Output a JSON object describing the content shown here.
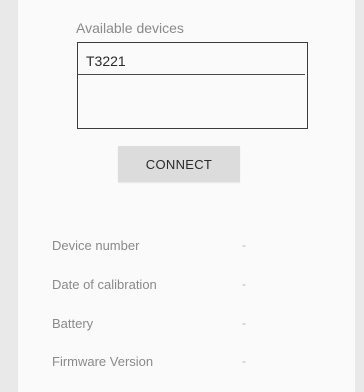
{
  "devices": {
    "label": "Available devices",
    "items": [
      {
        "name": "T3221"
      }
    ]
  },
  "actions": {
    "connect_label": "CONNECT"
  },
  "info": [
    {
      "label": "Device number",
      "value": "-"
    },
    {
      "label": "Date of calibration",
      "value": "-"
    },
    {
      "label": "Battery",
      "value": "-"
    },
    {
      "label": "Firmware Version",
      "value": "-"
    }
  ]
}
